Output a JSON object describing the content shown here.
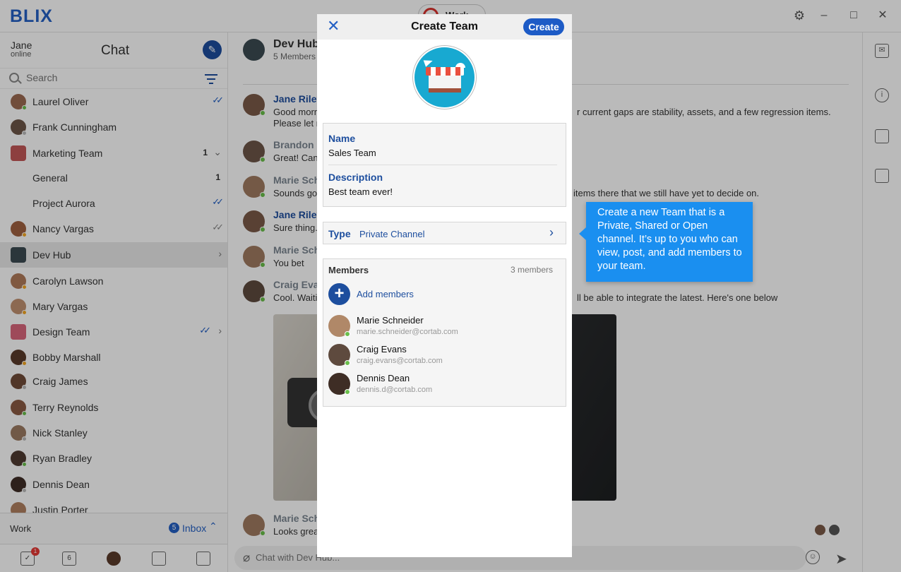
{
  "app": {
    "logo": "BLIX",
    "workspace": "Work"
  },
  "window": {
    "settings_icon": "gear-icon",
    "minimize": "–",
    "maximize": "□",
    "close": "✕"
  },
  "sidebar": {
    "user_name": "Jane",
    "user_status": "online",
    "title": "Chat",
    "search_placeholder": "Search",
    "conversations": [
      {
        "name": "Laurel Oliver",
        "status": "online",
        "read": "read"
      },
      {
        "name": "Frank Cunningham",
        "status": "offline"
      },
      {
        "name": "Marketing Team",
        "count": "1",
        "expand": "down"
      },
      {
        "name": "General",
        "count": "1",
        "indent": true
      },
      {
        "name": "Project Aurora",
        "read": "read",
        "indent": true
      },
      {
        "name": "Nancy Vargas",
        "status": "away",
        "read": "delivered"
      },
      {
        "name": "Dev Hub",
        "active": true,
        "expand": "right"
      },
      {
        "name": "Carolyn Lawson",
        "status": "away"
      },
      {
        "name": "Mary Vargas",
        "status": "away"
      },
      {
        "name": "Design Team",
        "read": "read",
        "expand": "right"
      },
      {
        "name": "Bobby Marshall",
        "status": "away"
      },
      {
        "name": "Craig James",
        "status": "offline"
      },
      {
        "name": "Terry Reynolds",
        "status": "online"
      },
      {
        "name": "Nick Stanley",
        "status": "offline"
      },
      {
        "name": "Ryan Bradley",
        "status": "online"
      },
      {
        "name": "Dennis Dean",
        "status": "offline"
      },
      {
        "name": "Justin Porter",
        "status": "offline"
      }
    ],
    "work_label": "Work",
    "inbox_count": "5",
    "inbox_label": "Inbox",
    "bottom_nav": {
      "tasks_badge": "1",
      "calendar_day": "6"
    }
  },
  "chat": {
    "channel_name": "Dev Hub",
    "members_text": "5 Members",
    "messages": [
      {
        "author": "Jane Riley",
        "line1": "Good morn",
        "line1_right": "r current gaps are stability, assets, and a few regression items.",
        "line2": "Please let r"
      },
      {
        "author": "Brandon H",
        "line1": "Great! Can"
      },
      {
        "author": "Marie Sch",
        "line1": "Sounds go",
        "line1_right": "items there that we still have yet to decide on."
      },
      {
        "author": "Jane Riley",
        "line1": "Sure thing."
      },
      {
        "author": "Marie Sch",
        "line1": "You bet"
      },
      {
        "author": "Craig Evan",
        "line1": "Cool. Waiti",
        "line1_right": "ll be able to integrate the latest. Here's one below"
      },
      {
        "author": "Marie Sch",
        "line1": "Looks grea"
      }
    ],
    "composer_placeholder": "Chat with Dev Hub..."
  },
  "modal": {
    "close": "✕",
    "title": "Create Team",
    "create_label": "Create",
    "name_label": "Name",
    "name_value": "Sales Team",
    "description_label": "Description",
    "description_value": "Best team ever!",
    "type_label": "Type",
    "type_value": "Private Channel",
    "members_label": "Members",
    "members_count": "3 members",
    "add_members_label": "Add members",
    "members": [
      {
        "name": "Marie Schneider",
        "email": "marie.schneider@cortab.com"
      },
      {
        "name": "Craig Evans",
        "email": "craig.evans@cortab.com"
      },
      {
        "name": "Dennis Dean",
        "email": "dennis.d@cortab.com"
      }
    ]
  },
  "tooltip": {
    "text": "Create a new Team that is a Private, Shared or Open channel. It’s up to you who can view, post, and add members to your team."
  },
  "colors": {
    "accent": "#1d4e9e",
    "button": "#1d5bc6",
    "tooltip": "#1a8ff0",
    "online": "#6abf4b"
  }
}
